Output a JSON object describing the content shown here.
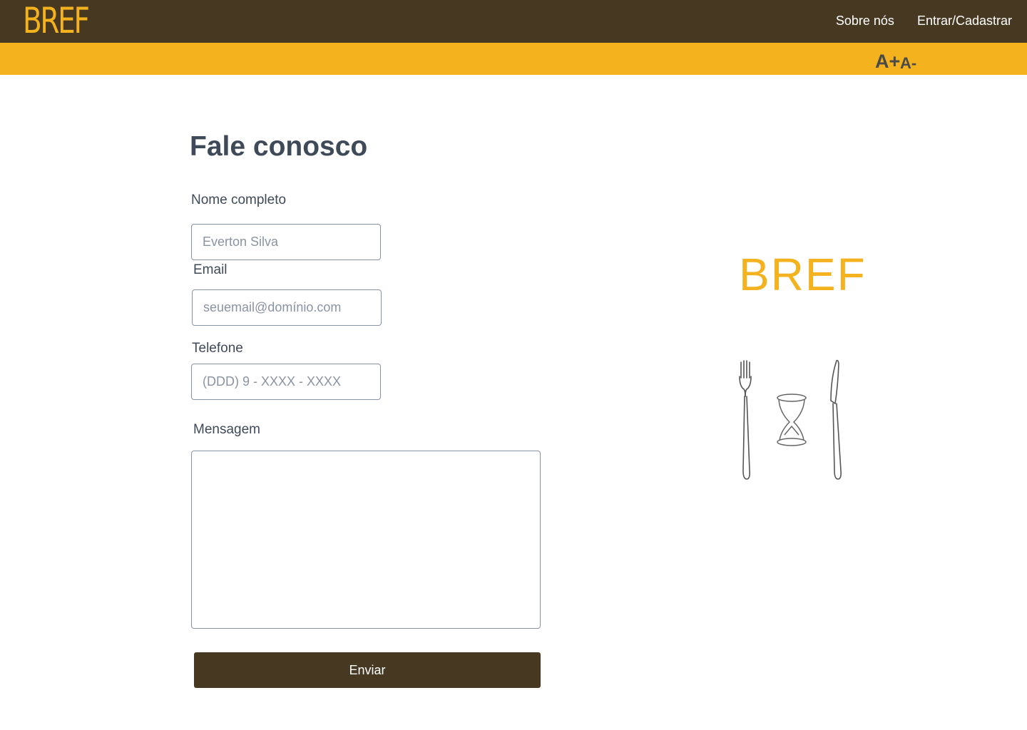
{
  "header": {
    "logo": "BREF",
    "nav": {
      "about": "Sobre nós",
      "login": "Entrar/Cadastrar"
    },
    "brand_color": "#f3b21e",
    "bar_color": "#473821"
  },
  "accessibility": {
    "increase_font": "A+",
    "decrease_font": "A-"
  },
  "form": {
    "title": "Fale conosco",
    "name_label": "Nome completo",
    "name_placeholder": "Everton Silva",
    "email_label": "Email",
    "email_placeholder": "seuemail@domínio.com",
    "phone_label": "Telefone",
    "phone_placeholder": "(DDD) 9 - XXXX - XXXX",
    "message_label": "Mensagem",
    "message_value": "",
    "submit_label": "Enviar"
  },
  "side": {
    "brand": "BREF",
    "illustration_icons": [
      "fork-icon",
      "hourglass-icon",
      "knife-icon"
    ]
  }
}
